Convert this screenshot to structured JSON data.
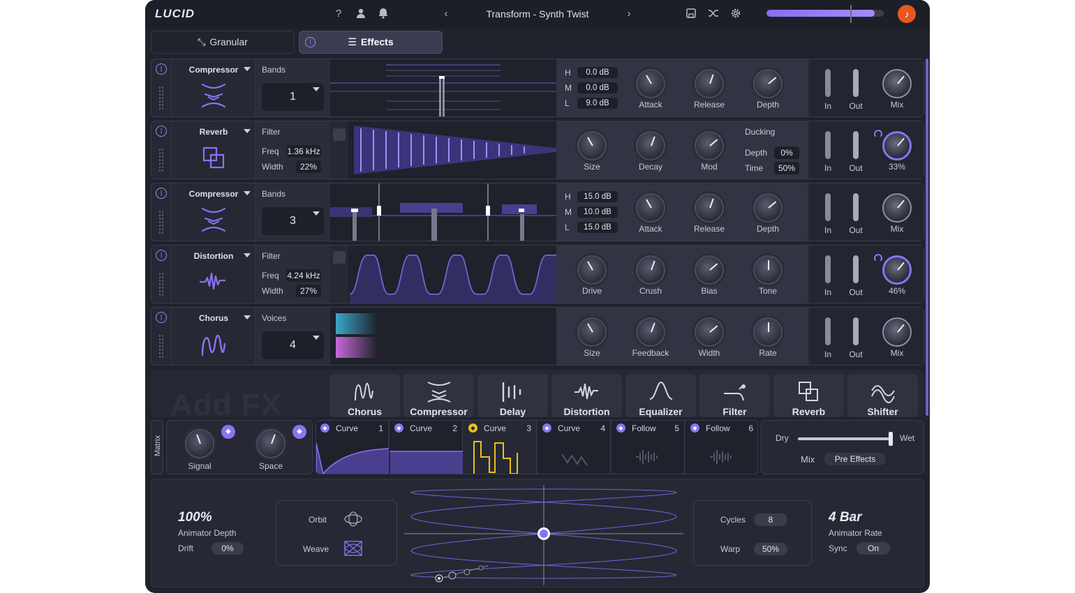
{
  "app": {
    "logo": "LUCID",
    "preset": "Transform - Synth Twist",
    "master_level": 0.92,
    "accent": "#8b73f4",
    "brand_icon_color": "#e8571e"
  },
  "tabs": [
    {
      "label": "Granular"
    },
    {
      "label": "Effects"
    }
  ],
  "fx": [
    {
      "name": "Compressor",
      "param_title": "Bands",
      "bands": "1",
      "hml": [
        {
          "k": "H",
          "v": "0.0 dB"
        },
        {
          "k": "M",
          "v": "0.0 dB"
        },
        {
          "k": "L",
          "v": "9.0 dB"
        }
      ],
      "knobs": [
        "Attack",
        "Release",
        "Depth"
      ],
      "in": "In",
      "out": "Out",
      "mix": "Mix"
    },
    {
      "name": "Reverb",
      "param_title": "Filter",
      "freq_label": "Freq",
      "freq": "1.36 kHz",
      "width_label": "Width",
      "width": "22%",
      "knobs": [
        "Size",
        "Decay",
        "Mod"
      ],
      "ducking": "Ducking",
      "duck_depth_label": "Depth",
      "duck_depth": "0%",
      "duck_time_label": "Time",
      "duck_time": "50%",
      "in": "In",
      "out": "Out",
      "mix": "33%"
    },
    {
      "name": "Compressor",
      "param_title": "Bands",
      "bands": "3",
      "hml": [
        {
          "k": "H",
          "v": "15.0 dB"
        },
        {
          "k": "M",
          "v": "10.0 dB"
        },
        {
          "k": "L",
          "v": "15.0 dB"
        }
      ],
      "knobs": [
        "Attack",
        "Release",
        "Depth"
      ],
      "in": "In",
      "out": "Out",
      "mix": "Mix"
    },
    {
      "name": "Distortion",
      "param_title": "Filter",
      "freq_label": "Freq",
      "freq": "4.24 kHz",
      "width_label": "Width",
      "width": "27%",
      "knobs": [
        "Drive",
        "Crush",
        "Bias",
        "Tone"
      ],
      "in": "In",
      "out": "Out",
      "mix": "46%"
    },
    {
      "name": "Chorus",
      "param_title": "Voices",
      "bands": "4",
      "knobs": [
        "Size",
        "Feedback",
        "Width",
        "Rate"
      ],
      "in": "In",
      "out": "Out",
      "mix": "Mix"
    }
  ],
  "add_fx": {
    "title": "Add FX",
    "items": [
      "Chorus",
      "Compressor",
      "Delay",
      "Distortion",
      "Equalizer",
      "Filter",
      "Reverb",
      "Shifter"
    ]
  },
  "matrix": {
    "label": "Matrix",
    "knobs": [
      "Signal",
      "Space"
    ],
    "mods": [
      {
        "t": "Curve",
        "n": "1"
      },
      {
        "t": "Curve",
        "n": "2"
      },
      {
        "t": "Curve",
        "n": "3"
      },
      {
        "t": "Curve",
        "n": "4"
      },
      {
        "t": "Follow",
        "n": "5"
      },
      {
        "t": "Follow",
        "n": "6"
      }
    ],
    "dry": "Dry",
    "wet": "Wet",
    "drywet": 0.98,
    "mix_label": "Mix",
    "mix_mode": "Pre Effects"
  },
  "animator": {
    "depth_value": "100%",
    "depth_label": "Animator Depth",
    "drift_label": "Drift",
    "drift": "0%",
    "orbit": "Orbit",
    "weave": "Weave",
    "cycles_label": "Cycles",
    "cycles": "8",
    "warp_label": "Warp",
    "warp": "50%",
    "rate_value": "4 Bar",
    "rate_label": "Animator Rate",
    "sync_label": "Sync",
    "sync": "On"
  }
}
